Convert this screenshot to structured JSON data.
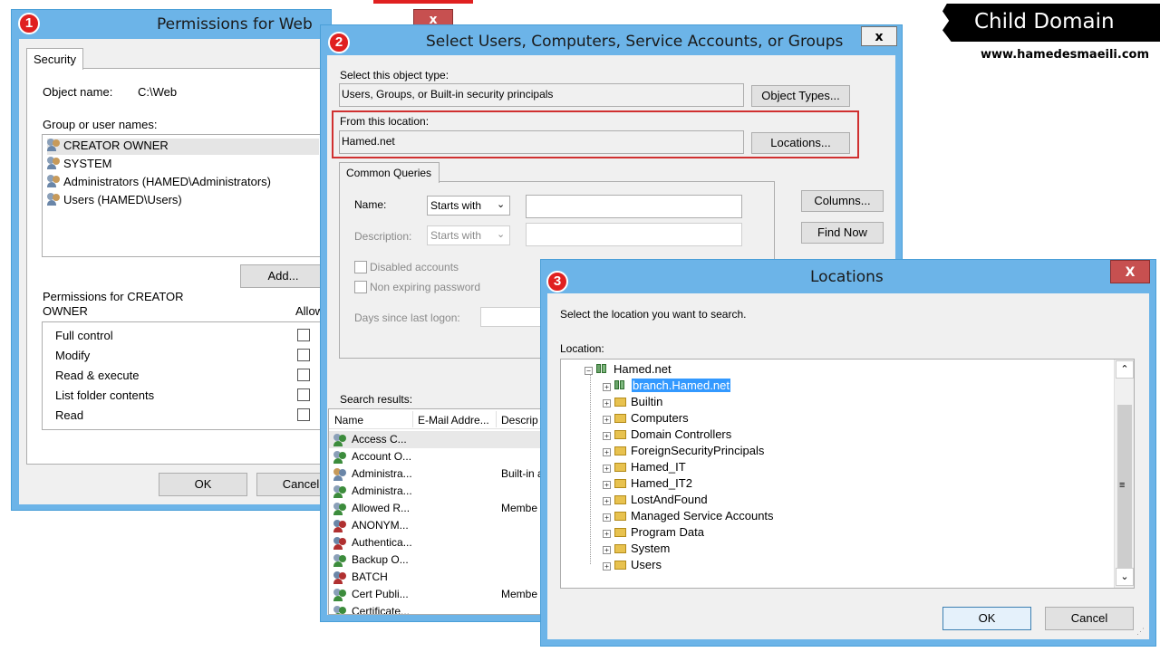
{
  "banner": {
    "title": "Child Domain",
    "website": "www.hamedesmaeili.com"
  },
  "badges": [
    "1",
    "2",
    "3"
  ],
  "perm": {
    "title": "Permissions for Web",
    "close": "x",
    "tab": "Security",
    "object_label": "Object name:",
    "object_value": "C:\\Web",
    "group_label": "Group or user names:",
    "users": [
      "CREATOR OWNER",
      "SYSTEM",
      "Administrators (HAMED\\Administrators)",
      "Users (HAMED\\Users)"
    ],
    "add": "Add...",
    "perm_for": "Permissions for CREATOR",
    "perm_for2": "OWNER",
    "allow": "Allow",
    "perms": [
      "Full control",
      "Modify",
      "Read & execute",
      "List folder contents",
      "Read"
    ],
    "ok": "OK",
    "cancel": "Cancel"
  },
  "select": {
    "title": "Select Users, Computers, Service Accounts, or Groups",
    "close": "x",
    "obj_type_label": "Select this object type:",
    "obj_type_value": "Users, Groups, or Built-in security principals",
    "obj_types_btn": "Object Types...",
    "loc_label": "From this location:",
    "loc_value": "Hamed.net",
    "locations_btn": "Locations...",
    "tab": "Common Queries",
    "name_label": "Name:",
    "name_op": "Starts with",
    "desc_label": "Description:",
    "desc_op": "Starts with",
    "disabled": "Disabled accounts",
    "nonexpiring": "Non expiring password",
    "days": "Days since last logon:",
    "columns": "Columns...",
    "findnow": "Find Now",
    "results_label": "Search results:",
    "cols": [
      "Name",
      "E-Mail Addre...",
      "Descrip"
    ],
    "results": [
      {
        "name": "Access C...",
        "desc": ""
      },
      {
        "name": "Account O...",
        "desc": ""
      },
      {
        "name": "Administra...",
        "desc": "Built-in a"
      },
      {
        "name": "Administra...",
        "desc": ""
      },
      {
        "name": "Allowed R...",
        "desc": "Membe"
      },
      {
        "name": "ANONYM...",
        "desc": ""
      },
      {
        "name": "Authentica...",
        "desc": ""
      },
      {
        "name": "Backup O...",
        "desc": ""
      },
      {
        "name": "BATCH",
        "desc": ""
      },
      {
        "name": "Cert Publi...",
        "desc": "Membe"
      },
      {
        "name": "Certificate...",
        "desc": ""
      }
    ]
  },
  "locations": {
    "title": "Locations",
    "close": "X",
    "instruction": "Select the location you want to search.",
    "location_label": "Location:",
    "root": "Hamed.net",
    "selected": "branch.Hamed.net",
    "children": [
      "Builtin",
      "Computers",
      "Domain Controllers",
      "ForeignSecurityPrincipals",
      "Hamed_IT",
      "Hamed_IT2",
      "LostAndFound",
      "Managed Service Accounts",
      "Program Data",
      "System",
      "Users"
    ],
    "ok": "OK",
    "cancel": "Cancel"
  }
}
